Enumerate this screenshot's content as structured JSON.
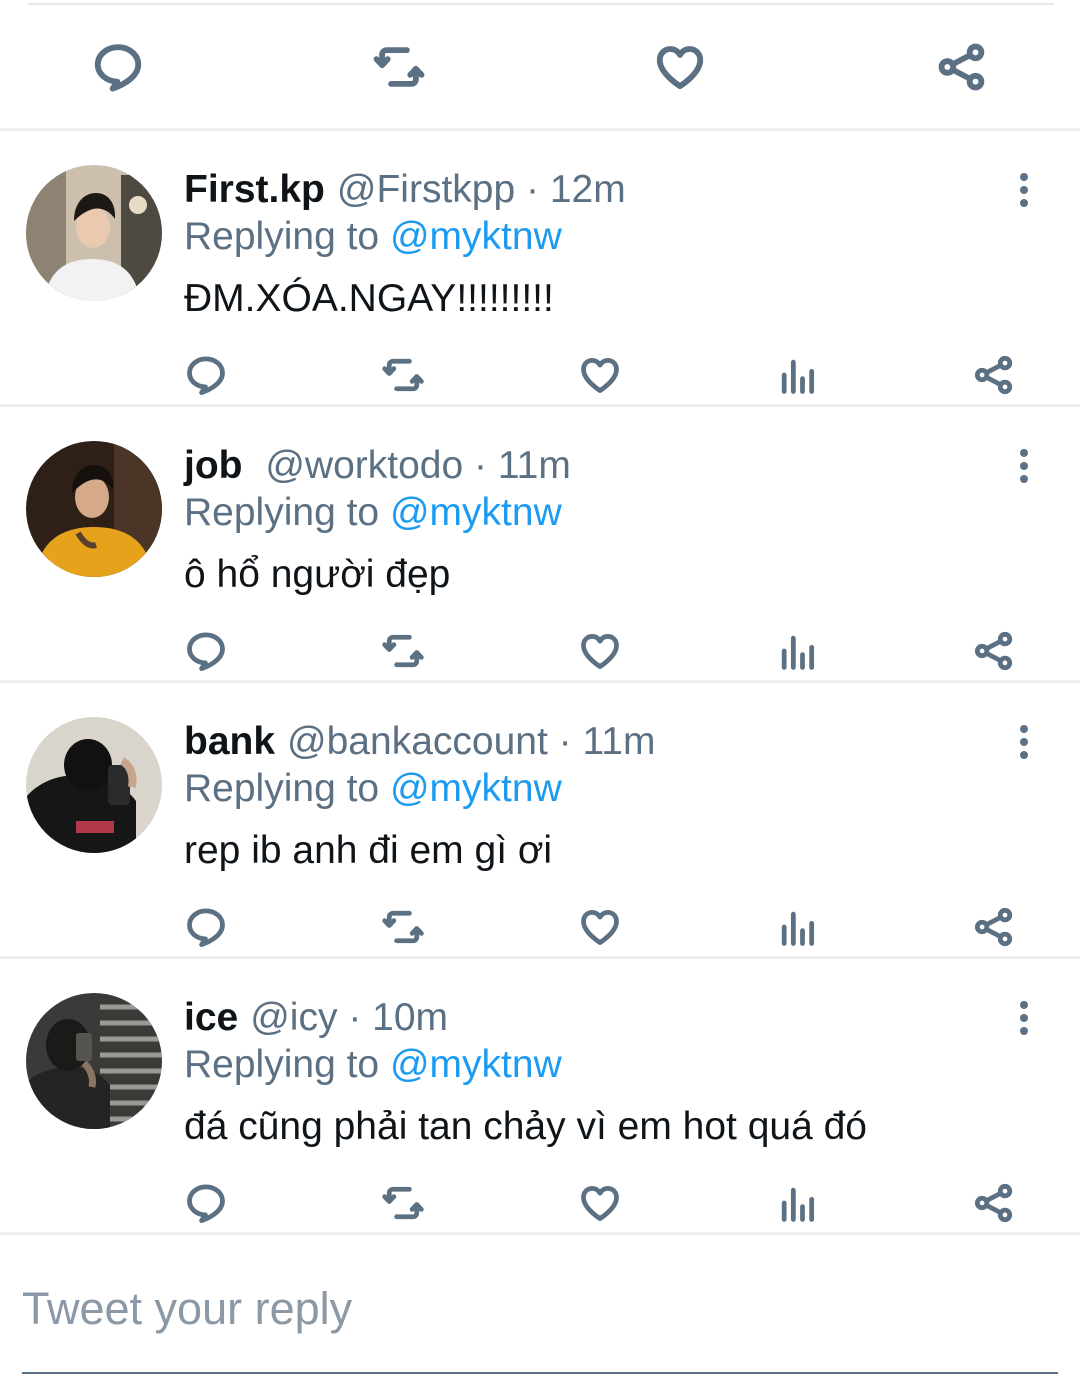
{
  "colors": {
    "icon": "#5b7083",
    "text": "#0f1419",
    "muted": "#5b7083",
    "link": "#1d9bf0",
    "divider": "#eceef0"
  },
  "main_actions": {
    "icons": [
      "reply-icon",
      "retweet-icon",
      "like-icon",
      "share-icon"
    ]
  },
  "replies": [
    {
      "name": "First.kp",
      "handle": "@Firstkpp",
      "time": "· 12m",
      "replying_label": "Replying to",
      "replying_to": "@myktnw",
      "text": "ĐM.XÓA.NGAY!!!!!!!!!"
    },
    {
      "name": "job",
      "handle": "@worktodo",
      "time": "· 11m",
      "replying_label": "Replying to",
      "replying_to": "@myktnw",
      "text": "ô hổ người đẹp"
    },
    {
      "name": "bank",
      "handle": "@bankaccount",
      "time": "· 11m",
      "replying_label": "Replying to",
      "replying_to": "@myktnw",
      "text": "rep ib anh đi em gì ơi"
    },
    {
      "name": "ice",
      "handle": "@icy",
      "time": "· 10m",
      "replying_label": "Replying to",
      "replying_to": "@myktnw",
      "text": "đá cũng phải tan chảy vì em hot quá đó"
    }
  ],
  "compose": {
    "placeholder": "Tweet your reply"
  }
}
